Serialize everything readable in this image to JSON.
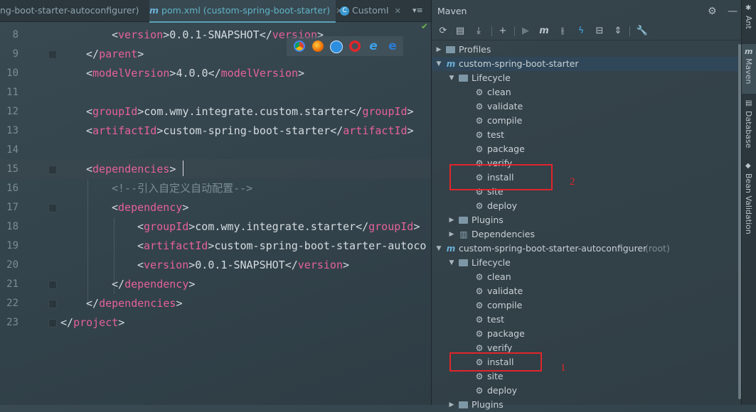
{
  "editor": {
    "tabs": [
      {
        "label": "ng-boot-starter-autoconfigurer)",
        "close": "✕"
      },
      {
        "label": "pom.xml (custom-spring-boot-starter)",
        "close": "✕"
      },
      {
        "label": "CustomI",
        "close": "✕"
      }
    ],
    "tab_more": "▾≡",
    "line_numbers": [
      "8",
      "9",
      "10",
      "11",
      "12",
      "13",
      "14",
      "15",
      "16",
      "17",
      "18",
      "19",
      "20",
      "21",
      "22",
      "23"
    ],
    "code": {
      "l8": {
        "open": "version",
        "text": "0.0.1-SNAPSHOT",
        "close": "version"
      },
      "l9": {
        "close": "parent"
      },
      "l10": {
        "open": "modelVersion",
        "text": "4.0.0",
        "close": "modelVersion"
      },
      "l12": {
        "open": "groupId",
        "text": "com.wmy.integrate.custom.starter",
        "close": "groupId"
      },
      "l13": {
        "open": "artifactId",
        "text": "custom-spring-boot-starter",
        "close": "artifactId"
      },
      "l15": {
        "open": "dependencies"
      },
      "l16": {
        "comment": "<!--引入自定义自动配置-->"
      },
      "l17": {
        "open": "dependency"
      },
      "l18": {
        "open": "groupId",
        "text": "com.wmy.integrate.starter",
        "close": "groupId"
      },
      "l19": {
        "open": "artifactId",
        "text": "custom-spring-boot-starter-autoco"
      },
      "l20": {
        "open": "version",
        "text": "0.0.1-SNAPSHOT",
        "close": "version"
      },
      "l21": {
        "close": "dependency"
      },
      "l22": {
        "close": "dependencies"
      },
      "l23": {
        "close": "project"
      }
    },
    "browsers": [
      "chrome-icon",
      "firefox-icon",
      "safari-icon",
      "opera-icon",
      "ie-icon",
      "edge-icon"
    ]
  },
  "maven": {
    "title": "Maven",
    "tree": {
      "profiles": "Profiles",
      "project1": "custom-spring-boot-starter",
      "lifecycle": "Lifecycle",
      "goals1": [
        "clean",
        "validate",
        "compile",
        "test",
        "package",
        "verify",
        "install",
        "site",
        "deploy"
      ],
      "plugins": "Plugins",
      "dependencies": "Dependencies",
      "project2": "custom-spring-boot-starter-autoconfigurer",
      "project2_note": "(root)",
      "goals2": [
        "clean",
        "validate",
        "compile",
        "test",
        "package",
        "verify",
        "install",
        "site",
        "deploy"
      ],
      "plugins2": "Plugins"
    },
    "annotations": {
      "box_top_label": "2",
      "box_bottom_label": "1"
    },
    "colors": {
      "annotation": "#e0262b",
      "selection": "#2f485a"
    }
  },
  "side_strip": [
    "Ant",
    "Maven",
    "Database",
    "Bean Validation"
  ]
}
